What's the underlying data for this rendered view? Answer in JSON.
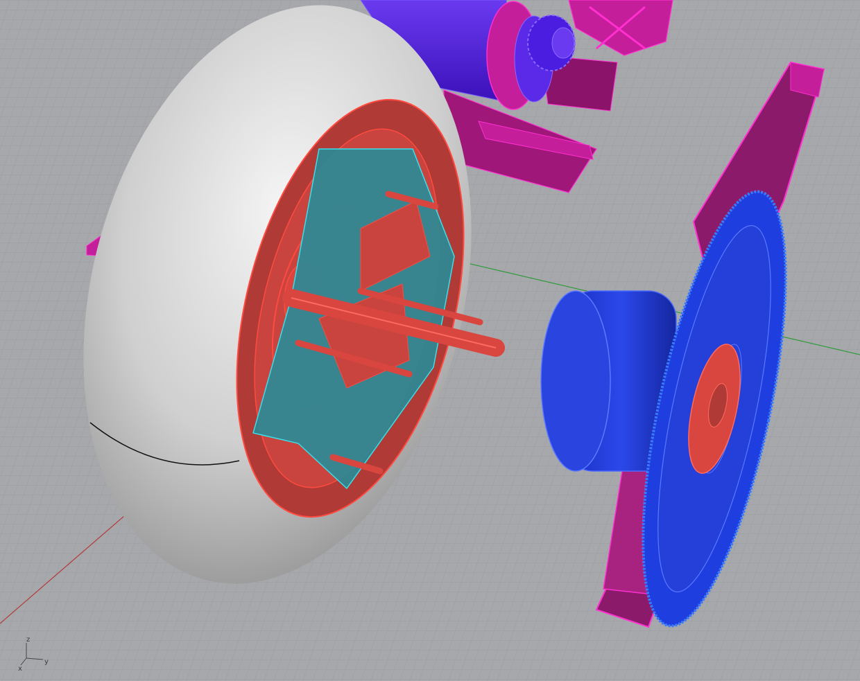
{
  "viewport": {
    "background": "#a6a8ab",
    "grid_minor_color": "#9c9ea1",
    "grid_major_color": "#8f9194",
    "x_axis_color": "#b33a3a",
    "y_axis_color": "#2f9a3a"
  },
  "axis_widget": {
    "z_label": "z",
    "y_label": "y",
    "x_label": "x"
  },
  "objects": [
    {
      "name": "tire",
      "color": "#d8d8d8"
    },
    {
      "name": "wheel-rim",
      "color": "#d9463f"
    },
    {
      "name": "hub-frame",
      "color": "#2b8a96"
    },
    {
      "name": "axle",
      "color": "#d9463f"
    },
    {
      "name": "motor-mount-bracket",
      "color": "#c41e9a"
    },
    {
      "name": "motor",
      "color": "#4a1de0"
    },
    {
      "name": "drive-pinion-gear",
      "color": "#4a1de0"
    },
    {
      "name": "drive-belt",
      "color": "#a8237f"
    },
    {
      "name": "driven-gear",
      "color": "#1e3ee0"
    },
    {
      "name": "hub-cylinder",
      "color": "#1e3ee0"
    },
    {
      "name": "gear-hub-plate",
      "color": "#d9463f"
    }
  ]
}
